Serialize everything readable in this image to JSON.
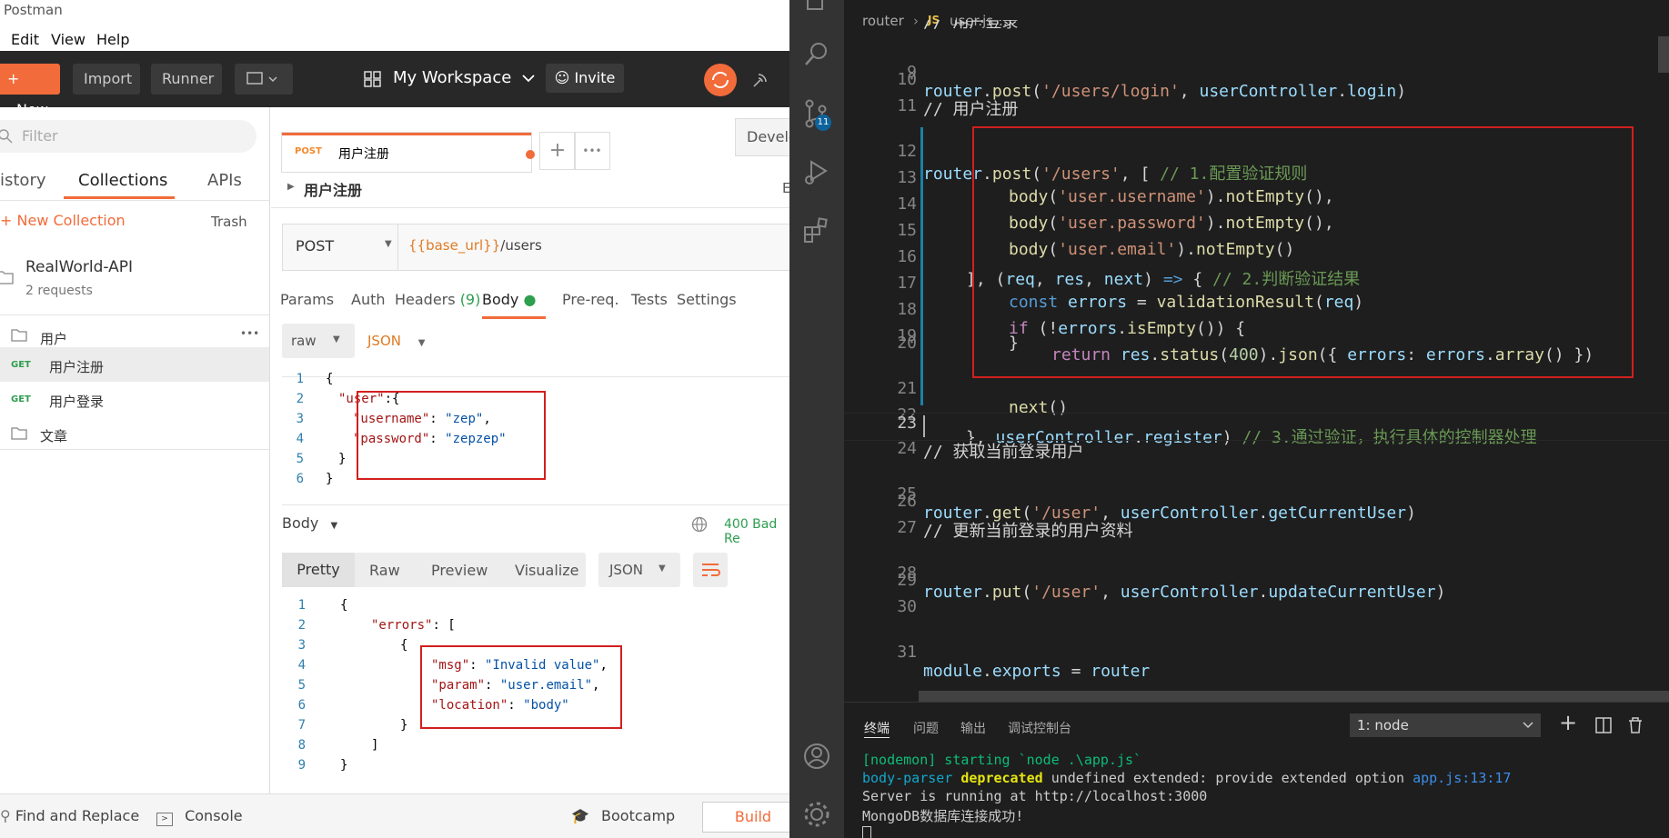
{
  "postman": {
    "title": "Postman",
    "menu": [
      "Edit",
      "View",
      "Help"
    ],
    "header": {
      "new_label": "New",
      "import_label": "Import",
      "runner_label": "Runner",
      "workspace": "My Workspace",
      "invite": "Invite"
    },
    "sidebar": {
      "filter_placeholder": "Filter",
      "tabs": [
        "istory",
        "Collections",
        "APIs"
      ],
      "new_collection": "New Collection",
      "trash": "Trash",
      "collection": {
        "name": "RealWorld-API",
        "count": "2 requests"
      },
      "folder_users": "用户",
      "more": "•••",
      "requests": [
        {
          "method": "GET",
          "name": "用户注册"
        },
        {
          "method": "GET",
          "name": "用户登录"
        }
      ],
      "folder_articles": "文章"
    },
    "tab": {
      "method": "POST",
      "name": "用户注册",
      "env": "Develo"
    },
    "request_title": "用户注册",
    "request_title_right": "E",
    "method_select": "POST",
    "url_var": "{{base_url}}",
    "url_path": "/users",
    "req_tabs": [
      "Params",
      "Auth",
      "Headers",
      "(9)",
      "Body",
      "Pre-req.",
      "Tests",
      "Settings"
    ],
    "body_mode": "raw",
    "body_lang": "JSON",
    "request_body": [
      {
        "n": "1",
        "text": "{"
      },
      {
        "n": "2",
        "k": "\"user\"",
        "rest": ":{"
      },
      {
        "n": "3",
        "k": "\"username\"",
        "v": "\"zep\"",
        "tail": ","
      },
      {
        "n": "4",
        "k": "\"password\"",
        "v": "\"zepzep\""
      },
      {
        "n": "5",
        "text": "}"
      },
      {
        "n": "6",
        "text": "}"
      }
    ],
    "response": {
      "label": "Body",
      "status": "400 Bad Re",
      "view_tabs": [
        "Pretty",
        "Raw",
        "Preview",
        "Visualize"
      ],
      "format": "JSON"
    },
    "response_body": {
      "l1": "{",
      "errors_key": "\"errors\"",
      "l2_rest": ": [",
      "l3": "{",
      "msg_k": "\"msg\"",
      "msg_v": "\"Invalid value\"",
      "param_k": "\"param\"",
      "param_v": "\"user.email\"",
      "loc_k": "\"location\"",
      "loc_v": "\"body\"",
      "l7": "}",
      "l8": "]",
      "l9": "}",
      "line_numbers": [
        "1",
        "2",
        "3",
        "4",
        "5",
        "6",
        "7",
        "8",
        "9"
      ]
    },
    "footer": {
      "find_replace": "Find and Replace",
      "console": "Console",
      "bootcamp": "Bootcamp",
      "build": "Build"
    }
  },
  "vscode": {
    "breadcrumb": [
      "router",
      "JS",
      "user.js",
      "..."
    ],
    "badge": "11",
    "terminal_tabs": [
      "终端",
      "问题",
      "输出",
      "调试控制台"
    ],
    "terminal_select": "1: node",
    "terminal_lines": {
      "l1": "[nodemon] starting `node .\\app.js`",
      "l2a": "body-parser",
      "l2b": "deprecated",
      "l2c": "undefined extended: provide extended option",
      "l2d": "app.js:13:17",
      "l3": "Server is running at http://localhost:3000",
      "l4": "MongoDB数据库连接成功!"
    },
    "code": {
      "l9_n": "9",
      "l10_n": "10",
      "l11_n": "11",
      "l12_n": "12",
      "l13_n": "13",
      "l14_n": "14",
      "l15_n": "15",
      "l16_n": "16",
      "l17_n": "17",
      "l18_n": "18",
      "l19_n": "19",
      "l20_n": "20",
      "l21_n": "21",
      "l22_n": "22",
      "l23_n": "23",
      "l24_n": "24",
      "l25_n": "25",
      "l26_n": "26",
      "l27_n": "27",
      "l28_n": "28",
      "l29_n": "29",
      "l30_n": "30",
      "l31_n": "31",
      "top_comment": "// 用户登录",
      "l9": {
        "a": "router",
        "b": ".",
        "c": "post",
        "d": "(",
        "e": "'/users/login'",
        "f": ", ",
        "g": "userController",
        "h": ".",
        "i": "login",
        "j": ")"
      },
      "l11": "// 用户注册",
      "l12": {
        "a": "router",
        "b": ".",
        "c": "post",
        "d": "(",
        "e": "'/users'",
        "f": ", [ ",
        "g": "// 1.配置验证规则"
      },
      "l13": {
        "a": "body",
        "b": "(",
        "c": "'user.username'",
        "d": ").",
        "e": "notEmpty",
        "f": "(),"
      },
      "l14": {
        "a": "body",
        "b": "(",
        "c": "'user.password'",
        "d": ").",
        "e": "notEmpty",
        "f": "(),"
      },
      "l15": {
        "a": "body",
        "b": "(",
        "c": "'user.email'",
        "d": ").",
        "e": "notEmpty",
        "f": "()"
      },
      "l16": {
        "a": "], (",
        "b": "req",
        "c": ", ",
        "d": "res",
        "e": ", ",
        "f": "next",
        "g": ") ",
        "h": "=>",
        "i": " { ",
        "j": "// 2.判断验证结果"
      },
      "l17": {
        "a": "const",
        "b": " ",
        "c": "errors",
        "d": " = ",
        "e": "validationResult",
        "f": "(",
        "g": "req",
        "h": ")"
      },
      "l18": {
        "a": "if",
        "b": " (!",
        "c": "errors",
        "d": ".",
        "e": "isEmpty",
        "f": "()) {"
      },
      "l19": {
        "a": "return",
        "b": " ",
        "c": "res",
        "d": ".",
        "e": "status",
        "f": "(",
        "g": "400",
        "h": ").",
        "i": "json",
        "j": "({ ",
        "k": "errors",
        "l": ": ",
        "m": "errors",
        "n": ".",
        "o": "array",
        "p": "() })"
      },
      "l20": "}",
      "l21": {
        "a": "next",
        "b": "()"
      },
      "l22": {
        "a": "}, ",
        "b": "userController",
        "c": ".",
        "d": "register",
        "e": ") ",
        "f": "// 3.通过验证，执行具体的控制器处理"
      },
      "l24": "// 获取当前登录用户",
      "l25": {
        "a": "router",
        "b": ".",
        "c": "get",
        "d": "(",
        "e": "'/user'",
        "f": ", ",
        "g": "userController",
        "h": ".",
        "i": "getCurrentUser",
        "j": ")"
      },
      "l27": "// 更新当前登录的用户资料",
      "l28": {
        "a": "router",
        "b": ".",
        "c": "put",
        "d": "(",
        "e": "'/user'",
        "f": ", ",
        "g": "userController",
        "h": ".",
        "i": "updateCurrentUser",
        "j": ")"
      },
      "l31": {
        "a": "module",
        "b": ".",
        "c": "exports",
        "d": " = ",
        "e": "router"
      }
    }
  },
  "colors": {
    "postman_orange": "#f26b3a",
    "highlight_red": "#d21f1f",
    "vscode_bg": "#1e1e1e"
  }
}
